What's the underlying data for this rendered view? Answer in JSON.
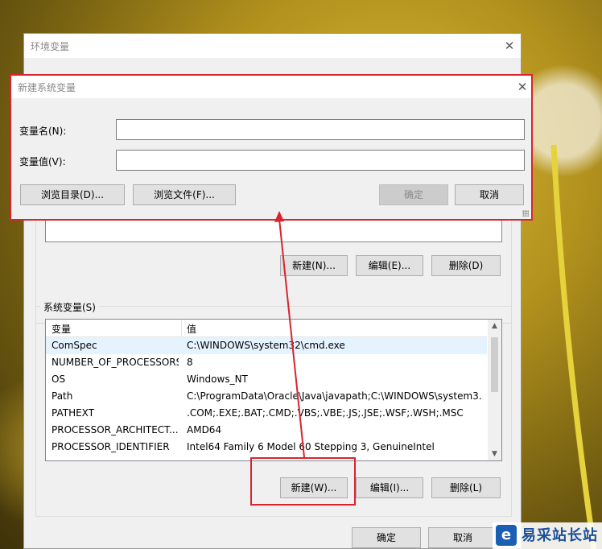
{
  "outer_dialog": {
    "title": "环境变量",
    "close_glyph": "✕",
    "user_buttons": {
      "new": "新建(N)...",
      "edit": "编辑(E)...",
      "delete": "删除(D)"
    },
    "system_group_label": "系统变量(S)",
    "system_table": {
      "columns": [
        "变量",
        "值"
      ],
      "rows": [
        {
          "name": "ComSpec",
          "value": "C:\\WINDOWS\\system32\\cmd.exe",
          "selected": true
        },
        {
          "name": "NUMBER_OF_PROCESSORS",
          "value": "8",
          "selected": false
        },
        {
          "name": "OS",
          "value": "Windows_NT",
          "selected": false
        },
        {
          "name": "Path",
          "value": "C:\\ProgramData\\Oracle\\Java\\javapath;C:\\WINDOWS\\system3...",
          "selected": false
        },
        {
          "name": "PATHEXT",
          "value": ".COM;.EXE;.BAT;.CMD;.VBS;.VBE;.JS;.JSE;.WSF;.WSH;.MSC",
          "selected": false
        },
        {
          "name": "PROCESSOR_ARCHITECT...",
          "value": "AMD64",
          "selected": false
        },
        {
          "name": "PROCESSOR_IDENTIFIER",
          "value": "Intel64 Family 6 Model 60 Stepping 3, GenuineIntel",
          "selected": false
        }
      ]
    },
    "system_buttons": {
      "new": "新建(W)...",
      "edit": "编辑(I)...",
      "delete": "删除(L)"
    },
    "ok": "确定",
    "cancel": "取消"
  },
  "new_var_dialog": {
    "title": "新建系统变量",
    "close_glyph": "✕",
    "name_label": "变量名(N):",
    "value_label": "变量值(V):",
    "name_value": "",
    "value_value": "",
    "browse_dir": "浏览目录(D)...",
    "browse_file": "浏览文件(F)...",
    "ok": "确定",
    "cancel": "取消"
  },
  "scroll_glyphs": {
    "up": "▲",
    "down": "▼"
  },
  "watermark": {
    "logo_glyph": "e",
    "text": "易采站长站"
  },
  "colors": {
    "annotation_red": "#d6252e",
    "window_bg": "#f0f0f0",
    "selected_row": "#e5f3ff"
  },
  "icons": [
    "close-icon",
    "scroll-up-icon",
    "scroll-down-icon",
    "resize-grip-icon",
    "annotation-arrow"
  ]
}
